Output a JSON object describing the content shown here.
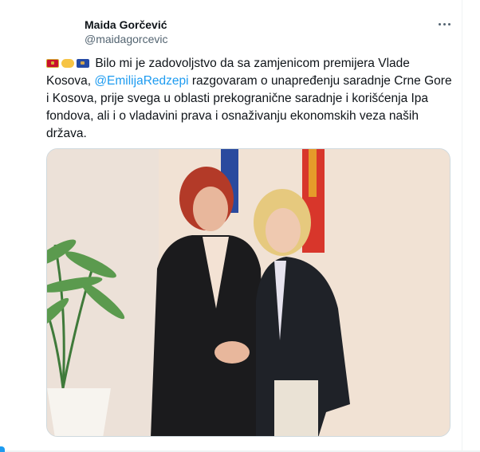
{
  "tweet": {
    "author": {
      "display_name": "Maida Gorčević",
      "handle": "@maidagorcevic"
    },
    "text": {
      "flags": [
        "flag-montenegro-icon",
        "handshake-icon",
        "flag-kosovo-icon"
      ],
      "part1": "Bilo mi je zadovoljstvo da sa zamjenicom premijera Vlade Kosova, ",
      "mention": "@EmilijaRedzepi",
      "part2": " razgovaram o unapređenju saradnje Crne Gore i Kosova, prije svega u oblasti prekogranične saradnje i korišćenja Ipa fondova, ali i o vladavini prava i osnaživanju ekonomskih veza naših država."
    },
    "photo": {
      "description_icon": "photo-two-women-handshake-icon"
    }
  },
  "colors": {
    "accent": "#1d9bf0",
    "text": "#0f1419",
    "muted": "#536471"
  }
}
